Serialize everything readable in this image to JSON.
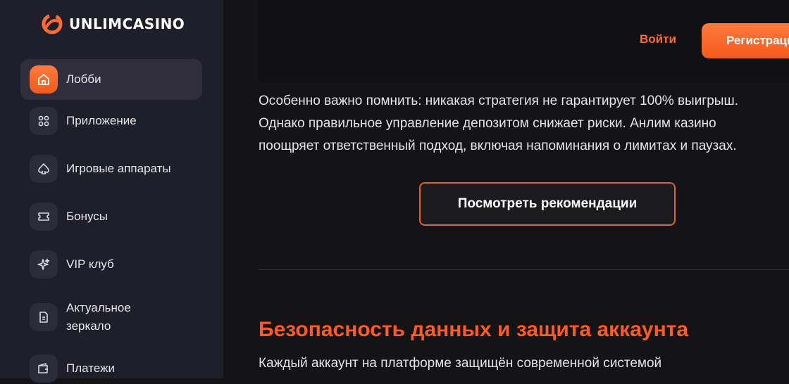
{
  "brand": {
    "name": "UNLIMCASINO",
    "accent": "#ff6b2e"
  },
  "sidebar": {
    "items": [
      {
        "label": "Лобби",
        "icon": "home-icon",
        "active": true
      },
      {
        "label": "Приложение",
        "icon": "grid-icon",
        "active": false
      },
      {
        "label": "Игровые аппараты",
        "icon": "spade-icon",
        "active": false
      },
      {
        "label": "Бонусы",
        "icon": "ticket-icon",
        "active": false
      },
      {
        "label": "VIP клуб",
        "icon": "sparkle-icon",
        "active": false
      },
      {
        "label_line1": "Актуальное",
        "label_line2": "зеркало",
        "icon": "document-icon",
        "active": false
      },
      {
        "label": "Платежи",
        "icon": "wallet-icon",
        "active": false
      }
    ]
  },
  "header": {
    "login_label": "Войти",
    "register_label": "Регистрация"
  },
  "content": {
    "paragraph_lines": [
      "Особенно важно помнить: никакая стратегия не гарантирует 100% выигрыш.",
      "Однако правильное управление депозитом снижает риски. Анлим казино",
      "поощряет ответственный подход, включая напоминания о лимитах и паузах."
    ],
    "recommendations_button": "Посмотреть рекомендации",
    "section_title": "Безопасность данных и защита аккаунта",
    "section_text": "Каждый аккаунт на платформе защищён современной системой"
  }
}
